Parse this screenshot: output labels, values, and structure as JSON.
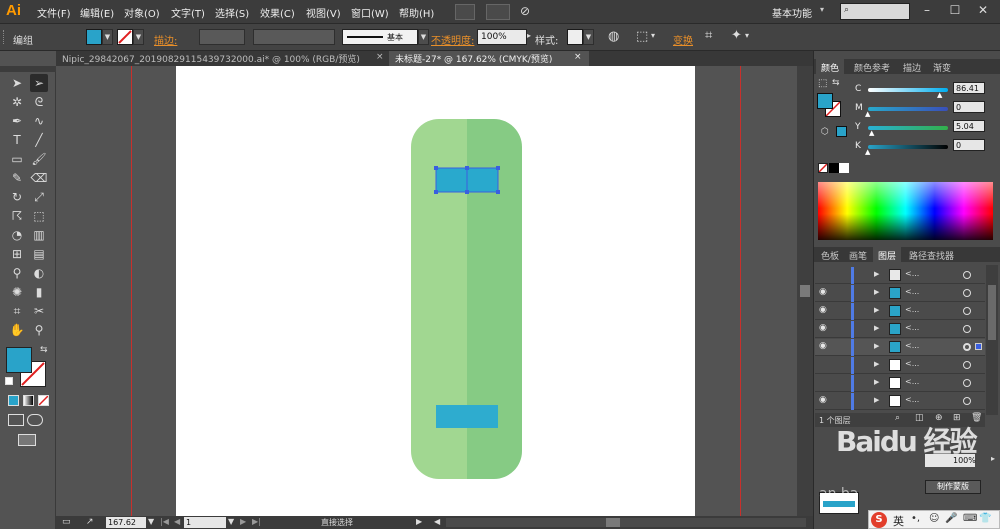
{
  "app": {
    "logo": "Ai"
  },
  "menubar": {
    "items": [
      "文件(F)",
      "编辑(E)",
      "对象(O)",
      "文字(T)",
      "选择(S)",
      "效果(C)",
      "视图(V)",
      "窗口(W)",
      "帮助(H)"
    ],
    "workspace": "基本功能"
  },
  "controlbar": {
    "selection_label": "编组",
    "stroke_label": "描边:",
    "stroke_profile": "基本",
    "opacity_label": "不透明度:",
    "opacity_value": "100%",
    "style_label": "样式:",
    "transform_label": "变换",
    "fill_color": "#29a3c9",
    "stroke_color": "#ffffff"
  },
  "tabs": [
    {
      "label": "Nipic_29842067_20190829115439732000.ai* @ 100% (RGB/预览)",
      "close": "×"
    },
    {
      "label": "未标题-27* @ 167.62% (CMYK/预览)",
      "close": "×"
    }
  ],
  "toolbar": {
    "tools": [
      "selection-tool",
      "direct-selection-tool",
      "magic-wand-tool",
      "lasso-tool",
      "pen-tool",
      "curvature-tool",
      "type-tool",
      "line-tool",
      "rectangle-tool",
      "paintbrush-tool",
      "pencil-tool",
      "eraser-tool",
      "rotate-tool",
      "scale-tool",
      "warp-tool",
      "free-transform-tool",
      "shape-builder-tool",
      "perspective-grid-tool",
      "mesh-tool",
      "gradient-tool",
      "eyedropper-tool",
      "blend-tool",
      "symbol-sprayer-tool",
      "column-graph-tool",
      "artboard-tool",
      "slice-tool",
      "hand-tool",
      "zoom-tool"
    ],
    "fill_color": "#29a3c9"
  },
  "artwork": {
    "body_left_color": "#a1d791",
    "body_right_color": "#86cb84",
    "top_strip_color": "#29a9cd",
    "bottom_strip_color": "#2eaccf"
  },
  "statusbar": {
    "zoom": "167.62",
    "page": "1",
    "tool_name": "直接选择"
  },
  "color_panel": {
    "tabs": [
      "颜色",
      "颜色参考",
      "描边",
      "渐变"
    ],
    "channels": [
      {
        "label": "C",
        "value": "86.41",
        "pos": 0.864
      },
      {
        "label": "M",
        "value": "0",
        "pos": 0.0
      },
      {
        "label": "Y",
        "value": "5.04",
        "pos": 0.05
      },
      {
        "label": "K",
        "value": "0",
        "pos": 0.0
      }
    ],
    "fill_color": "#29a3c9"
  },
  "layers_panel": {
    "tabs": [
      "色板",
      "画笔",
      "图层",
      "路径查找器"
    ],
    "rows": [
      {
        "eye": "",
        "name": "<...",
        "thumb": "#e8e8e8",
        "highlight": false
      },
      {
        "eye": "◉",
        "name": "<...",
        "thumb": "#2aa4c8",
        "highlight": false
      },
      {
        "eye": "◉",
        "name": "<...",
        "thumb": "#2aa4c8",
        "highlight": false
      },
      {
        "eye": "◉",
        "name": "<...",
        "thumb": "#2aa4c8",
        "highlight": false
      },
      {
        "eye": "◉",
        "name": "<...",
        "thumb": "#2aa4c8",
        "highlight": true
      },
      {
        "eye": "",
        "name": "<...",
        "thumb": "#ffffff",
        "highlight": false
      },
      {
        "eye": "",
        "name": "<...",
        "thumb": "#ffffff",
        "highlight": false
      },
      {
        "eye": "◉",
        "name": "<...",
        "thumb": "#ffffff",
        "highlight": false
      },
      {
        "eye": "◉",
        "name": "<...",
        "thumb": "#ffffff",
        "highlight": false
      }
    ],
    "footer_label": "1 个图层",
    "make_mask_label": "制作蒙版"
  },
  "watermark": {
    "text": "Baidu 经验",
    "sub": "an.ba"
  },
  "ime": {
    "label": "英"
  }
}
